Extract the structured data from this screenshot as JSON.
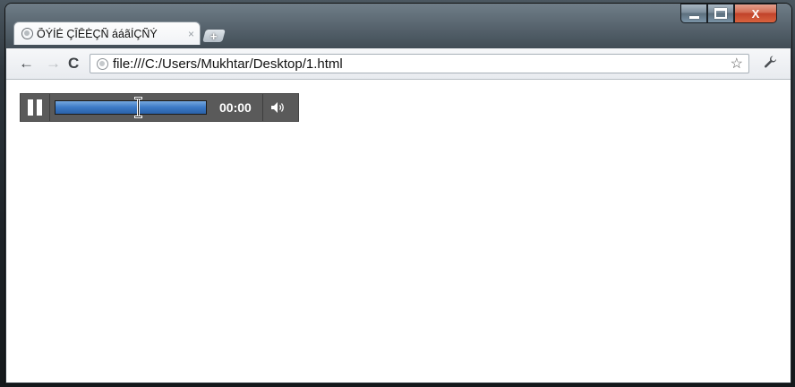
{
  "window": {
    "controls": {
      "minimize_icon": "minimize-icon",
      "maximize_icon": "maximize-icon",
      "close_label": "X"
    }
  },
  "tab": {
    "title": "ÕÝÍÉ ÇÎÊÈÇÑ ááãÍÇÑÝ",
    "close_label": "×",
    "favicon": "page-globe-icon"
  },
  "new_tab": {
    "label": "+"
  },
  "toolbar": {
    "back_label": "←",
    "forward_label": "→",
    "reload_label": "C",
    "url": "file:///C:/Users/Mukhtar/Desktop/1.html",
    "star_label": "☆",
    "wrench_icon": "wrench-icon"
  },
  "player": {
    "state": "playing",
    "time": "00:00",
    "progress": 1.0,
    "volume_icon": "speaker-icon"
  },
  "colors": {
    "progress_fill": "#3b79c6",
    "player_bg": "#5a5a5a",
    "close_button": "#c0422a"
  }
}
